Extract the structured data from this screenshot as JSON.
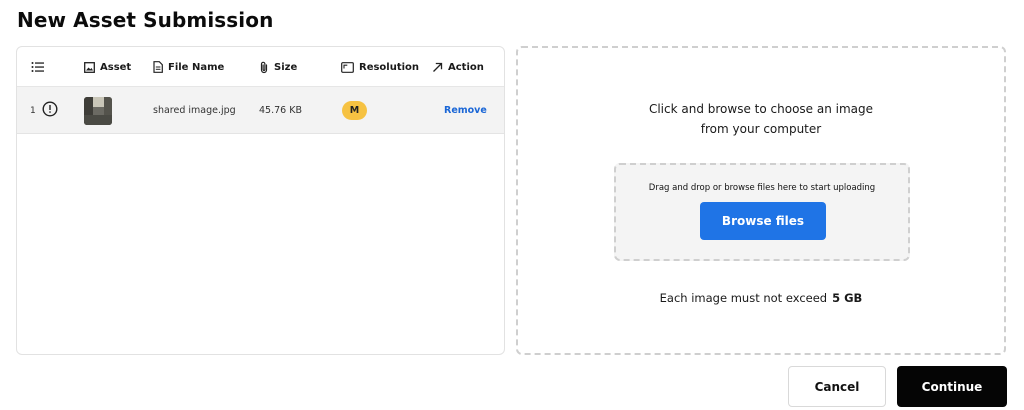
{
  "page": {
    "title": "New Asset Submission"
  },
  "table": {
    "headers": {
      "asset": "Asset",
      "file_name": "File Name",
      "size": "Size",
      "resolution": "Resolution",
      "action": "Action"
    },
    "rows": [
      {
        "index": "1",
        "status_icon": "alert-circle-icon",
        "file_name": "shared image.jpg",
        "size": "45.76 KB",
        "resolution": "M",
        "action": "Remove"
      }
    ]
  },
  "upload": {
    "heading_line1": "Click and browse to choose an image",
    "heading_line2": "from your computer",
    "dropzone_text": "Drag and drop or browse files here to start uploading",
    "browse_label": "Browse files",
    "limit_text": "Each image must not exceed",
    "limit_value": "5 GB"
  },
  "footer": {
    "cancel_label": "Cancel",
    "continue_label": "Continue"
  },
  "colors": {
    "accent": "#1f74e6",
    "badge": "#f6c242",
    "primary_button": "#050505",
    "link": "#1a66d6"
  }
}
